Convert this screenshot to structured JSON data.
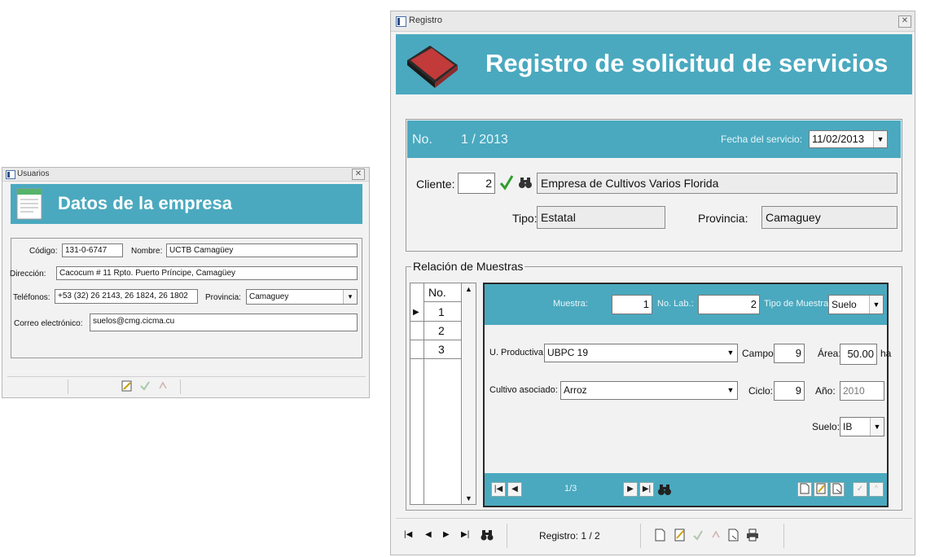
{
  "left_window": {
    "title": "Usuarios",
    "close_glyph": "✕",
    "banner_title": "Datos de la empresa",
    "fields": {
      "codigo_label": "Código:",
      "codigo_value": "131-0-6747",
      "nombre_label": "Nombre:",
      "nombre_value": "UCTB Camagüey",
      "direccion_label": "Dirección:",
      "direccion_value": "Cacocum # 11 Rpto. Puerto Príncipe, Camagüey",
      "telefonos_label": "Teléfonos:",
      "telefonos_value": "+53 (32) 26 2143, 26 1824, 26 1802",
      "provincia_label": "Provincia:",
      "provincia_value": "Camaguey",
      "correo_label": "Correo electrónico:",
      "correo_value": "suelos@cmg.cicma.cu"
    },
    "footer_icons": [
      "edit-icon",
      "check-icon",
      "cancel-icon"
    ]
  },
  "right_window": {
    "title": "Registro",
    "close_glyph": "✕",
    "banner_title": "Registro de solicitud de servicios",
    "header": {
      "no_label": "No.",
      "no_value": "1 / 2013",
      "fecha_label": "Fecha del servicio:",
      "fecha_value": "11/02/2013"
    },
    "client": {
      "cliente_label": "Cliente:",
      "cliente_value": "2",
      "cliente_name": "Empresa de Cultivos Varios Florida",
      "tipo_label": "Tipo:",
      "tipo_value": "Estatal",
      "provincia_label": "Provincia:",
      "provincia_value": "Camaguey"
    },
    "muestras": {
      "group_label": "Relación de Muestras",
      "list_header": "No.",
      "rows": [
        "1",
        "2",
        "3"
      ],
      "muestra_label": "Muestra:",
      "muestra_value": "1",
      "nolab_label": "No. Lab.:",
      "nolab_value": "2",
      "tipo_label": "Tipo de Muestra:",
      "tipo_value": "Suelo",
      "uproductiva_label": "U. Productiva:",
      "uproductiva_value": "UBPC 19",
      "campo_label": "Campo:",
      "campo_value": "9",
      "area_label": "Área:",
      "area_value": "50.00",
      "area_unit": "ha",
      "cultivo_label": "Cultivo asociado:",
      "cultivo_value": "Arroz",
      "ciclo_label": "Ciclo:",
      "ciclo_value": "9",
      "anio_label": "Año:",
      "anio_value": "2010",
      "suelo_label": "Suelo:",
      "suelo_value": "IB",
      "nav_counter": "1/3"
    },
    "status": {
      "registro_text": "Registro: 1 / 2"
    }
  }
}
